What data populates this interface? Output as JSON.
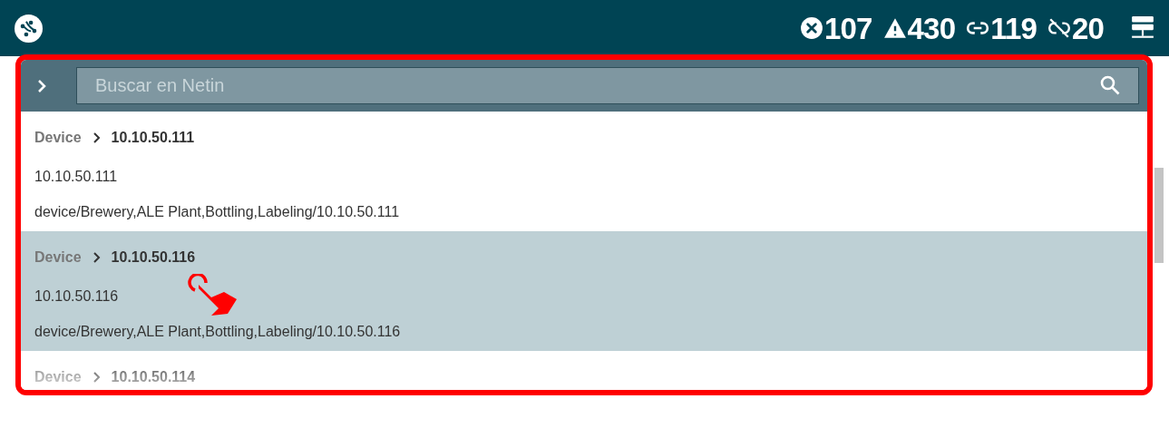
{
  "top_bar": {
    "stats": [
      {
        "kind": "error",
        "value": "107"
      },
      {
        "kind": "warning",
        "value": "430"
      },
      {
        "kind": "link",
        "value": "119"
      },
      {
        "kind": "unlink",
        "value": "20"
      }
    ]
  },
  "search": {
    "placeholder": "Buscar en Netin"
  },
  "results": [
    {
      "category": "Device",
      "title": "10.10.50.111",
      "value": "10.10.50.111",
      "path": "device/Brewery,ALE Plant,Bottling,Labeling/10.10.50.111",
      "selected": false
    },
    {
      "category": "Device",
      "title": "10.10.50.116",
      "value": "10.10.50.116",
      "path": "device/Brewery,ALE Plant,Bottling,Labeling/10.10.50.116",
      "selected": true
    },
    {
      "category": "Device",
      "title": "10.10.50.114",
      "selected": false
    }
  ]
}
